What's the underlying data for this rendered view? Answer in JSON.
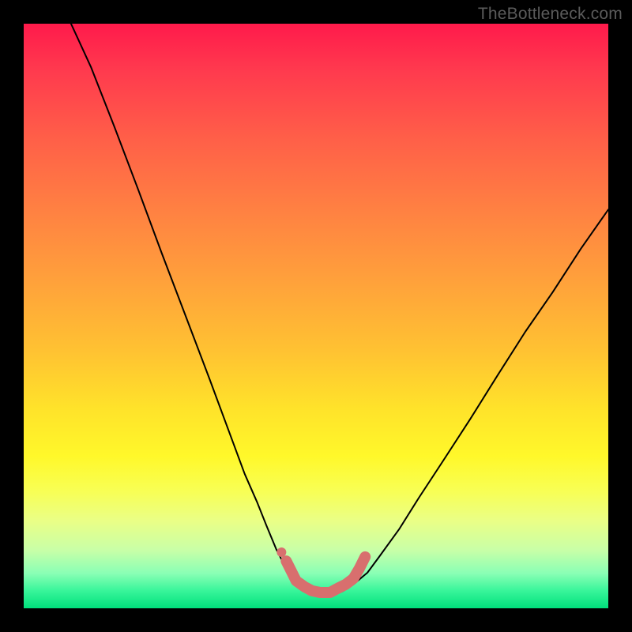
{
  "watermark": "TheBottleneck.com",
  "chart_data": {
    "type": "line",
    "title": "",
    "xlabel": "",
    "ylabel": "",
    "xlim": [
      0,
      100
    ],
    "ylim": [
      0,
      100
    ],
    "grid": false,
    "series": [
      {
        "name": "bottleneck-curve",
        "color": "#000000",
        "points": [
          {
            "x": 8.1,
            "y": 100.0
          },
          {
            "x": 11.5,
            "y": 92.6
          },
          {
            "x": 15.5,
            "y": 82.4
          },
          {
            "x": 19.6,
            "y": 71.6
          },
          {
            "x": 23.6,
            "y": 60.8
          },
          {
            "x": 27.7,
            "y": 50.0
          },
          {
            "x": 31.8,
            "y": 39.2
          },
          {
            "x": 35.8,
            "y": 28.4
          },
          {
            "x": 37.8,
            "y": 23.0
          },
          {
            "x": 39.9,
            "y": 18.2
          },
          {
            "x": 41.5,
            "y": 14.2
          },
          {
            "x": 43.2,
            "y": 10.1
          },
          {
            "x": 44.6,
            "y": 7.4
          },
          {
            "x": 45.9,
            "y": 5.4
          },
          {
            "x": 46.9,
            "y": 4.1
          },
          {
            "x": 48.0,
            "y": 3.0
          },
          {
            "x": 49.0,
            "y": 2.4
          },
          {
            "x": 50.3,
            "y": 2.0
          },
          {
            "x": 51.7,
            "y": 2.0
          },
          {
            "x": 53.4,
            "y": 2.4
          },
          {
            "x": 54.7,
            "y": 3.0
          },
          {
            "x": 56.4,
            "y": 4.1
          },
          {
            "x": 58.8,
            "y": 6.1
          },
          {
            "x": 60.8,
            "y": 8.8
          },
          {
            "x": 64.2,
            "y": 13.5
          },
          {
            "x": 67.6,
            "y": 18.9
          },
          {
            "x": 71.6,
            "y": 25.0
          },
          {
            "x": 76.4,
            "y": 32.4
          },
          {
            "x": 81.1,
            "y": 39.9
          },
          {
            "x": 85.8,
            "y": 47.3
          },
          {
            "x": 90.5,
            "y": 54.1
          },
          {
            "x": 95.3,
            "y": 61.5
          },
          {
            "x": 100.0,
            "y": 68.2
          }
        ]
      }
    ],
    "annotations": [
      {
        "name": "valley-marker",
        "color": "#d86f6e",
        "points": [
          {
            "x": 44.9,
            "y": 8.1
          },
          {
            "x": 45.9,
            "y": 6.1
          },
          {
            "x": 46.6,
            "y": 4.7
          },
          {
            "x": 48.0,
            "y": 3.7
          },
          {
            "x": 49.3,
            "y": 3.0
          },
          {
            "x": 50.7,
            "y": 2.7
          },
          {
            "x": 52.4,
            "y": 2.7
          },
          {
            "x": 53.7,
            "y": 3.4
          },
          {
            "x": 55.1,
            "y": 4.1
          },
          {
            "x": 56.4,
            "y": 5.1
          },
          {
            "x": 57.4,
            "y": 6.8
          },
          {
            "x": 58.4,
            "y": 8.8
          }
        ]
      }
    ]
  }
}
